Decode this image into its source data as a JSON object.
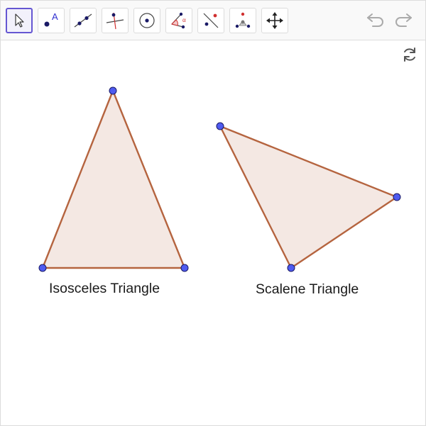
{
  "toolbar": {
    "tools": [
      {
        "name": "move-tool",
        "icon": "arrow-cursor-icon",
        "selected": true
      },
      {
        "name": "point-tool",
        "icon": "point-icon",
        "icon_letter": "A"
      },
      {
        "name": "line-tool",
        "icon": "line-icon"
      },
      {
        "name": "perpendicular-line-tool",
        "icon": "perpendicular-line-icon"
      },
      {
        "name": "circle-tool",
        "icon": "circle-with-center-icon"
      },
      {
        "name": "angle-tool",
        "icon": "angle-icon",
        "icon_letter": "α"
      },
      {
        "name": "reflect-tool",
        "icon": "reflect-about-line-icon"
      },
      {
        "name": "slider-tool",
        "icon": "slider-icon"
      },
      {
        "name": "move-graphics-view-tool",
        "icon": "move-graphics-view-icon"
      }
    ],
    "undo_icon": "undo-icon",
    "redo_icon": "redo-icon"
  },
  "refresh_icon": "refresh-icon",
  "colors": {
    "accent": "#6557d2",
    "edge": "#b5643f",
    "fill": "#f4e8e3",
    "point_fill": "#4f5bf0",
    "point_stroke": "#1a1a66",
    "toolbar_bg": "#f9f9f9",
    "disabled": "#aaaaaa"
  },
  "shapes": [
    {
      "label": "Isosceles Triangle"
    },
    {
      "label": "Scalene Triangle"
    }
  ]
}
